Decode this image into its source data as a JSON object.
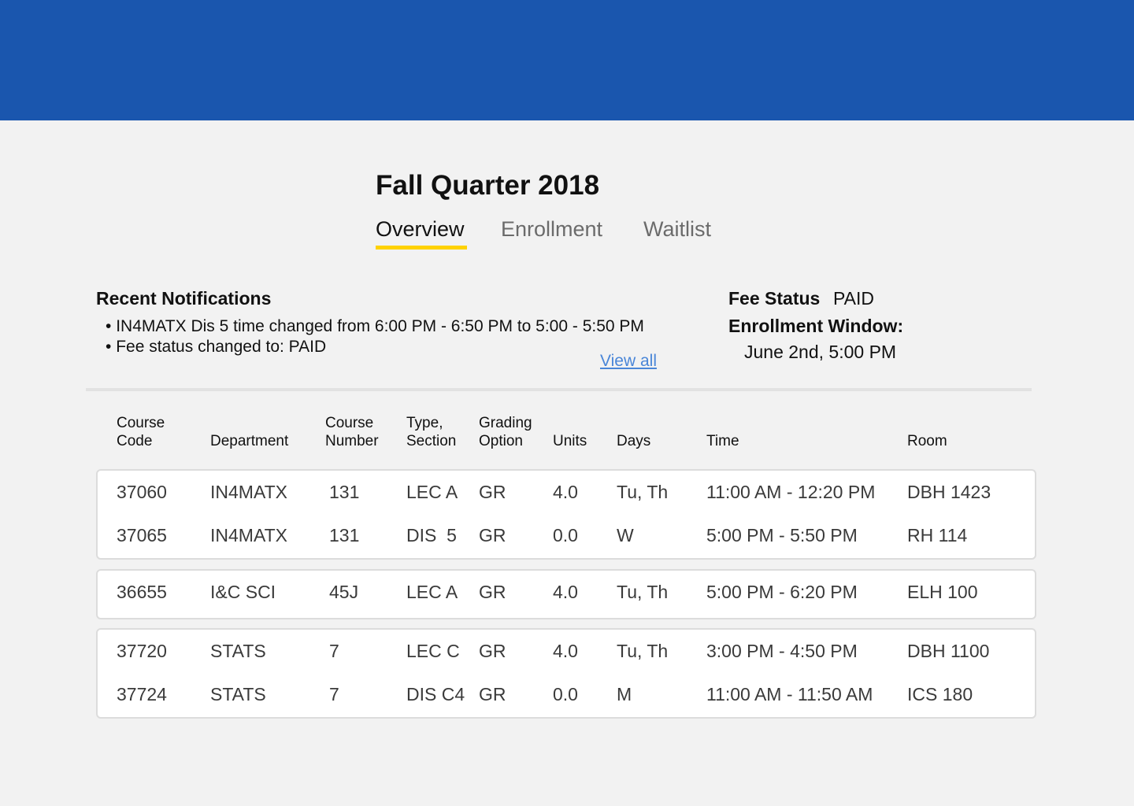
{
  "header": {
    "title": "Fall Quarter 2018"
  },
  "tabs": [
    {
      "label": "Overview",
      "active": true
    },
    {
      "label": "Enrollment",
      "active": false
    },
    {
      "label": "Waitlist",
      "active": false
    }
  ],
  "notifications": {
    "title": "Recent Notifications",
    "items": [
      "IN4MATX Dis 5 time changed from 6:00 PM - 6:50 PM to 5:00 - 5:50 PM",
      "Fee status changed to: PAID"
    ],
    "view_all_label": "View all"
  },
  "status": {
    "fee_label": "Fee Status",
    "fee_value": "PAID",
    "window_label": "Enrollment Window:",
    "window_value": "June 2nd, 5:00 PM"
  },
  "table": {
    "columns": [
      {
        "key": "code",
        "lines": [
          "Course",
          "Code"
        ]
      },
      {
        "key": "department",
        "lines": [
          "",
          "Department"
        ]
      },
      {
        "key": "number",
        "lines": [
          "Course",
          "Number"
        ]
      },
      {
        "key": "section",
        "lines": [
          "Type,",
          "Section"
        ]
      },
      {
        "key": "grading",
        "lines": [
          "Grading",
          "Option"
        ]
      },
      {
        "key": "units",
        "lines": [
          "",
          "Units"
        ]
      },
      {
        "key": "days",
        "lines": [
          "",
          "Days"
        ]
      },
      {
        "key": "time",
        "lines": [
          "",
          "Time"
        ]
      },
      {
        "key": "room",
        "lines": [
          "",
          "Room"
        ]
      }
    ],
    "groups": [
      [
        {
          "code": "37060",
          "department": "IN4MATX",
          "number": "131",
          "section": "LEC A",
          "grading": "GR",
          "units": "4.0",
          "days": "Tu, Th",
          "time": "11:00 AM - 12:20 PM",
          "room": "DBH 1423"
        },
        {
          "code": "37065",
          "department": "IN4MATX",
          "number": "131",
          "section": "DIS  5",
          "grading": "GR",
          "units": "0.0",
          "days": "W",
          "time": "5:00 PM - 5:50 PM",
          "room": "RH 114"
        }
      ],
      [
        {
          "code": "36655",
          "department": "I&C SCI",
          "number": "45J",
          "section": "LEC A",
          "grading": "GR",
          "units": "4.0",
          "days": "Tu, Th",
          "time": "5:00 PM - 6:20 PM",
          "room": "ELH 100"
        }
      ],
      [
        {
          "code": "37720",
          "department": "STATS",
          "number": "7",
          "section": "LEC C",
          "grading": "GR",
          "units": "4.0",
          "days": "Tu, Th",
          "time": "3:00 PM - 4:50 PM",
          "room": "DBH 1100"
        },
        {
          "code": "37724",
          "department": "STATS",
          "number": "7",
          "section": "DIS C4",
          "grading": "GR",
          "units": "0.0",
          "days": "M",
          "time": "11:00 AM - 11:50 AM",
          "room": "ICS 180"
        }
      ]
    ]
  },
  "colors": {
    "header_bar": "#1a56ae",
    "tab_indicator": "#ffd200",
    "link": "#4a86d8",
    "background": "#f2f2f2"
  }
}
